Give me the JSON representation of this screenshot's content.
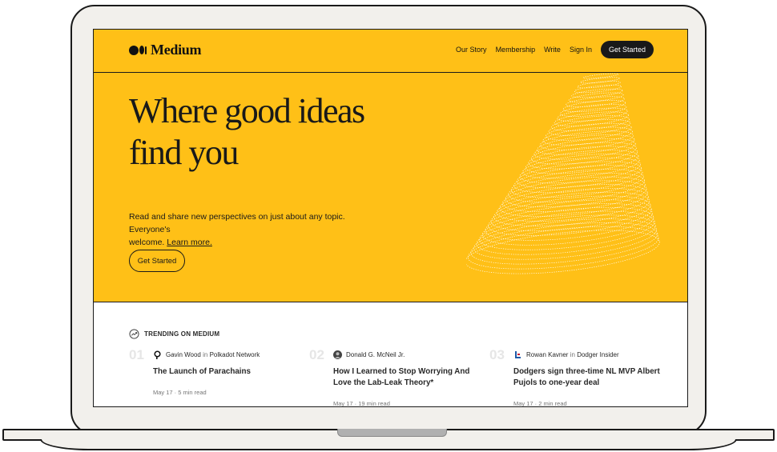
{
  "brand": {
    "name": "Medium"
  },
  "nav": {
    "our_story": "Our Story",
    "membership": "Membership",
    "write": "Write",
    "sign_in": "Sign In",
    "get_started": "Get Started"
  },
  "hero": {
    "title_line1": "Where good ideas",
    "title_line2": "find you",
    "subtitle_line1": "Read and share new perspectives on just about any topic. Everyone's",
    "subtitle_line2_prefix": "welcome. ",
    "learn_more": "Learn more.",
    "cta": "Get Started"
  },
  "trending": {
    "label": "TRENDING ON MEDIUM",
    "items": [
      {
        "num": "01",
        "author": "Gavin Wood",
        "connector": "in",
        "publication": "Polkadot Network",
        "title": "The Launch of Parachains",
        "meta": "May 17 · 5 min read"
      },
      {
        "num": "02",
        "author": "Donald G. McNeil Jr.",
        "connector": "",
        "publication": "",
        "title": "How I Learned to Stop Worrying And Love the Lab-Leak Theory*",
        "meta": "May 17 · 19 min read"
      },
      {
        "num": "03",
        "author": "Rowan Kavner",
        "connector": "in",
        "publication": "Dodger Insider",
        "title": "Dodgers sign three-time NL MVP Albert Pujols to one-year deal",
        "meta": "May 17 · 2 min read"
      }
    ]
  },
  "colors": {
    "accent": "#ffc017",
    "dark": "#191919"
  }
}
